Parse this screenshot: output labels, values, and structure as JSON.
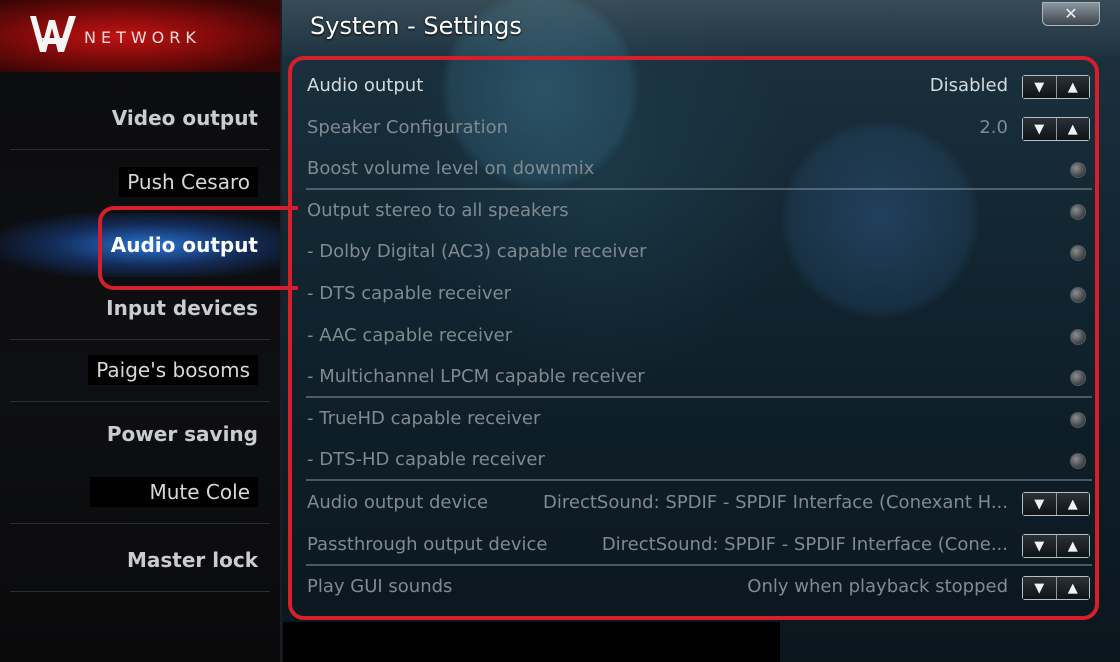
{
  "header": {
    "title": "System - Settings",
    "close_label": "✕"
  },
  "logo": {
    "text": "NETWORK"
  },
  "sidebar": {
    "items": [
      {
        "label": "Video output"
      },
      {
        "label": "Push Cesaro"
      },
      {
        "label": "Audio output"
      },
      {
        "label": "Input devices"
      },
      {
        "label": "Paige's bosoms"
      },
      {
        "label": "Power saving"
      },
      {
        "label": "Mute Cole"
      },
      {
        "label": "Master lock"
      }
    ]
  },
  "settings": {
    "rows": [
      {
        "label": "Audio output",
        "value": "Disabled"
      },
      {
        "label": "Speaker Configuration",
        "value": "2.0"
      },
      {
        "label": "Boost volume level on downmix"
      },
      {
        "label": "Output stereo to all speakers"
      },
      {
        "label": "- Dolby Digital (AC3) capable receiver"
      },
      {
        "label": "- DTS capable receiver"
      },
      {
        "label": "- AAC capable receiver"
      },
      {
        "label": "- Multichannel LPCM capable receiver"
      },
      {
        "label": "- TrueHD capable receiver"
      },
      {
        "label": "- DTS-HD capable receiver"
      },
      {
        "label": "Audio output device",
        "value": "DirectSound: SPDIF - SPDIF Interface (Conexant H..."
      },
      {
        "label": "Passthrough output device",
        "value": "DirectSound: SPDIF - SPDIF Interface (Cone..."
      },
      {
        "label": "Play GUI sounds",
        "value": "Only when playback stopped"
      }
    ]
  },
  "colors": {
    "highlight_outline": "#d4202a",
    "active_item": "#2878dc"
  }
}
